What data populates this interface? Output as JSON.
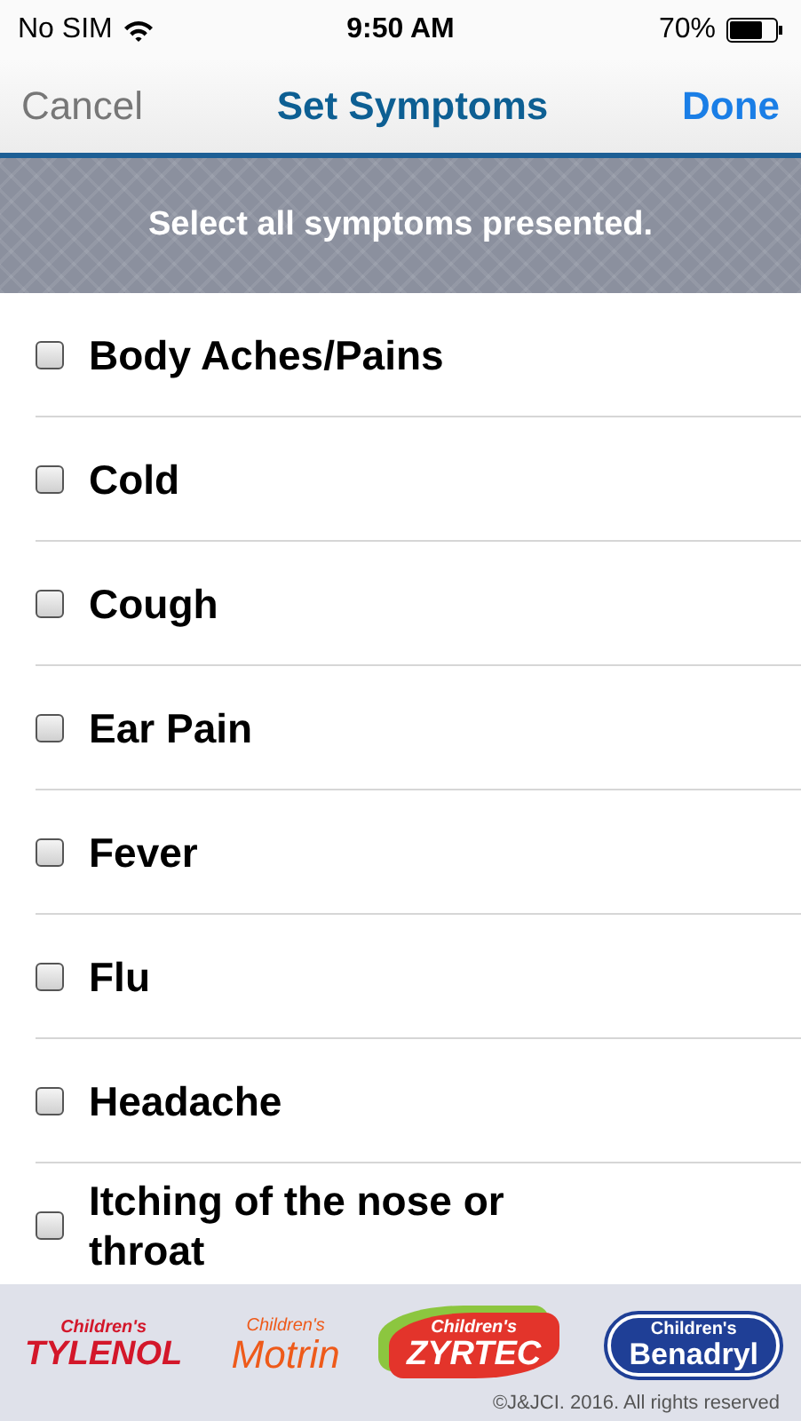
{
  "status_bar": {
    "carrier": "No SIM",
    "time": "9:50 AM",
    "battery": "70%"
  },
  "nav": {
    "cancel": "Cancel",
    "title": "Set Symptoms",
    "done": "Done"
  },
  "banner": "Select all symptoms presented.",
  "symptoms": [
    {
      "label": "Body Aches/Pains",
      "checked": false
    },
    {
      "label": "Cold",
      "checked": false
    },
    {
      "label": "Cough",
      "checked": false
    },
    {
      "label": "Ear Pain",
      "checked": false
    },
    {
      "label": "Fever",
      "checked": false
    },
    {
      "label": "Flu",
      "checked": false
    },
    {
      "label": "Headache",
      "checked": false
    },
    {
      "label": "Itching of the nose or throat",
      "checked": false
    }
  ],
  "footer": {
    "logos": [
      {
        "kind": "tylenol",
        "small": "Children's",
        "big": "TYLENOL"
      },
      {
        "kind": "motrin",
        "small": "Children's",
        "big": "Motrin"
      },
      {
        "kind": "zyrtec",
        "small": "Children's",
        "big": "ZYRTEC"
      },
      {
        "kind": "benadryl",
        "small": "Children's",
        "big": "Benadryl"
      }
    ],
    "copyright": "©J&JCI. 2016. All rights reserved"
  }
}
